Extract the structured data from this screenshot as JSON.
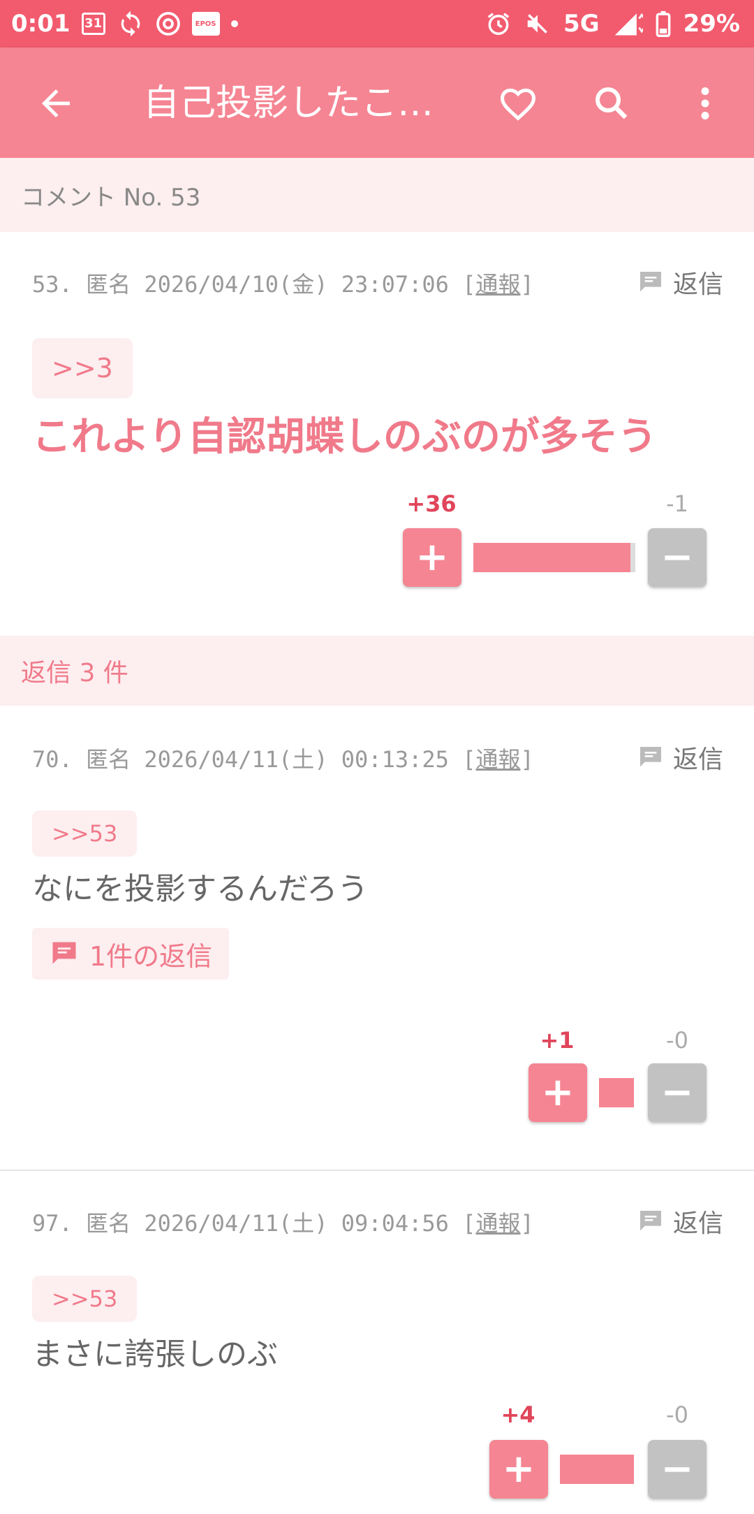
{
  "status_bar": {
    "time": "0:01",
    "calendar_day": "31",
    "epos_label": "EPOS",
    "network": "5G",
    "battery": "29%"
  },
  "app_bar": {
    "title": "自己投影したこ…",
    "icons": [
      "back-icon",
      "heart-icon",
      "search-icon",
      "more-icon"
    ]
  },
  "section_comment": {
    "label": "コメント No. 53"
  },
  "parent_comment": {
    "meta": "53.  匿名  2026/04/10(金) 23:07:06 ",
    "report": "通報",
    "reply_label": "返信",
    "anchor": ">>3",
    "body": "これより自認胡蝶しのぶのが多そう",
    "plus": "+36",
    "minus": "-1",
    "plus_ratio": 0.97
  },
  "section_replies": {
    "label": "返信 3 件"
  },
  "replies": [
    {
      "meta": "70.  匿名  2026/04/11(土) 00:13:25 ",
      "report": "通報",
      "reply_label": "返信",
      "anchor": ">>53",
      "body": "なにを投影するんだろう",
      "thread_label": "1件の返信",
      "plus": "+1",
      "minus": "-0",
      "plus_ratio": 1.0
    },
    {
      "meta": "97.  匿名  2026/04/11(土) 09:04:56 ",
      "report": "通報",
      "reply_label": "返信",
      "anchor": ">>53",
      "body": "まさに誇張しのぶ",
      "plus": "+4",
      "minus": "-0",
      "plus_ratio": 1.0
    }
  ],
  "colors": {
    "status_bar": "#f25a6e",
    "app_bar": "#f58593",
    "accent_text": "#f07a8a",
    "plus_count": "#e0455a",
    "minus_button": "#c2c2c2",
    "section_bg": "#fdeef0"
  }
}
